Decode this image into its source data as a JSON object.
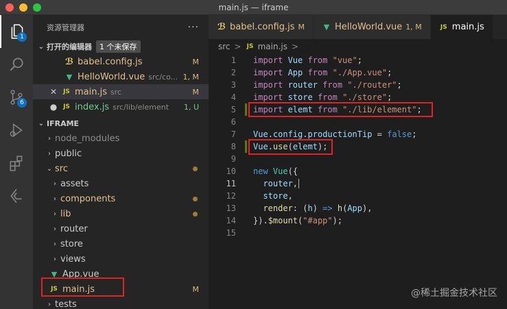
{
  "window": {
    "title": "main.js — iframe"
  },
  "activity_bar": {
    "items": [
      {
        "icon": "files-icon",
        "badge": "1"
      },
      {
        "icon": "search-icon",
        "badge": ""
      },
      {
        "icon": "source-control-icon",
        "badge": "6"
      },
      {
        "icon": "run-debug-icon",
        "badge": ""
      },
      {
        "icon": "extensions-icon",
        "badge": ""
      },
      {
        "icon": "remote-explorer-icon",
        "badge": ""
      }
    ]
  },
  "sidebar": {
    "title": "资源管理器",
    "more": "···",
    "open_editors": {
      "label": "打开的编辑器",
      "unsaved": "1 个未保存",
      "files": [
        {
          "icon": "babel-icon",
          "name": "babel.config.js",
          "desc": "",
          "status": "M",
          "lead": ""
        },
        {
          "icon": "vue-icon",
          "name": "HelloWorld.vue",
          "desc": "src/co...",
          "status": "1, M",
          "lead": ""
        },
        {
          "icon": "js-icon",
          "name": "main.js",
          "desc": "src",
          "status": "M",
          "lead": "✕"
        },
        {
          "icon": "js-icon",
          "name": "index.js",
          "desc": "src/lib/element",
          "status": "1, U",
          "lead": "●"
        }
      ]
    },
    "project": {
      "label": "IFRAME",
      "tree": [
        {
          "name": "node_modules",
          "type": "folder",
          "depth": 0,
          "open": false,
          "status": ""
        },
        {
          "name": "public",
          "type": "folder",
          "depth": 0,
          "open": false,
          "status": ""
        },
        {
          "name": "src",
          "type": "folder",
          "depth": 0,
          "open": true,
          "status": "dot"
        },
        {
          "name": "assets",
          "type": "folder",
          "depth": 1,
          "open": false,
          "status": ""
        },
        {
          "name": "components",
          "type": "folder",
          "depth": 1,
          "open": false,
          "status": "dot"
        },
        {
          "name": "lib",
          "type": "folder",
          "depth": 1,
          "open": false,
          "status": "dot"
        },
        {
          "name": "router",
          "type": "folder",
          "depth": 1,
          "open": false,
          "status": ""
        },
        {
          "name": "store",
          "type": "folder",
          "depth": 1,
          "open": false,
          "status": ""
        },
        {
          "name": "views",
          "type": "folder",
          "depth": 1,
          "open": false,
          "status": ""
        },
        {
          "name": "App.vue",
          "type": "vue",
          "depth": 1,
          "open": false,
          "status": ""
        },
        {
          "name": "main.js",
          "type": "js",
          "depth": 1,
          "open": false,
          "status": "M"
        },
        {
          "name": "tests",
          "type": "folder",
          "depth": 0,
          "open": false,
          "status": ""
        }
      ]
    }
  },
  "tabs": [
    {
      "icon": "babel-icon",
      "label": "babel.config.js",
      "status": "M"
    },
    {
      "icon": "vue-icon",
      "label": "HelloWorld.vue",
      "status": "1, M"
    },
    {
      "icon": "js-icon",
      "label": "main.js",
      "status": ""
    }
  ],
  "breadcrumb": {
    "folder": "src",
    "sep": ">",
    "file_icon": "JS",
    "file": "main.js",
    "trail": ">"
  },
  "code": [
    [
      [
        "import ",
        "kc"
      ],
      [
        "Vue ",
        "v"
      ],
      [
        "from ",
        "kc"
      ],
      [
        "\"vue\"",
        "s"
      ],
      [
        ";",
        "p"
      ]
    ],
    [
      [
        "import ",
        "kc"
      ],
      [
        "App ",
        "v"
      ],
      [
        "from ",
        "kc"
      ],
      [
        "\"./App.vue\"",
        "s"
      ],
      [
        ";",
        "p"
      ]
    ],
    [
      [
        "import ",
        "kc"
      ],
      [
        "router ",
        "v"
      ],
      [
        "from ",
        "kc"
      ],
      [
        "\"./router\"",
        "s"
      ],
      [
        ";",
        "p"
      ]
    ],
    [
      [
        "import ",
        "kc"
      ],
      [
        "store ",
        "v"
      ],
      [
        "from ",
        "kc"
      ],
      [
        "\"./store\"",
        "s"
      ],
      [
        ";",
        "p"
      ]
    ],
    [
      [
        "import ",
        "kc"
      ],
      [
        "elemt ",
        "v"
      ],
      [
        "from ",
        "kc"
      ],
      [
        "\"./lib/element\"",
        "s"
      ],
      [
        ";",
        "p"
      ]
    ],
    [],
    [
      [
        "Vue",
        "v"
      ],
      [
        ".",
        "p"
      ],
      [
        "config",
        "v"
      ],
      [
        ".",
        "p"
      ],
      [
        "productionTip",
        "v"
      ],
      [
        " = ",
        "p"
      ],
      [
        "false",
        "k"
      ],
      [
        ";",
        "p"
      ]
    ],
    [
      [
        "Vue",
        "v"
      ],
      [
        ".",
        "p"
      ],
      [
        "use",
        "f"
      ],
      [
        "(",
        "p"
      ],
      [
        "elemt",
        "v"
      ],
      [
        ");",
        "p"
      ]
    ],
    [],
    [
      [
        "new ",
        "k"
      ],
      [
        "Vue",
        "t"
      ],
      [
        "({",
        "p"
      ]
    ],
    [
      [
        "  router",
        "v"
      ],
      [
        ",",
        "p"
      ]
    ],
    [
      [
        "  store",
        "v"
      ],
      [
        ",",
        "p"
      ]
    ],
    [
      [
        "  render",
        "f"
      ],
      [
        ": (",
        "p"
      ],
      [
        "h",
        "v"
      ],
      [
        ") ",
        "p"
      ],
      [
        "=>",
        "k"
      ],
      [
        " ",
        "p"
      ],
      [
        "h",
        "f"
      ],
      [
        "(",
        "p"
      ],
      [
        "App",
        "v"
      ],
      [
        "),",
        "p"
      ]
    ],
    [
      [
        "})",
        "p"
      ],
      [
        ".",
        "p"
      ],
      [
        "$mount",
        "f"
      ],
      [
        "(",
        "p"
      ],
      [
        "\"#app\"",
        "s"
      ],
      [
        ");",
        "p"
      ]
    ],
    []
  ],
  "current_line": 11,
  "watermark": "@稀土掘金技术社区"
}
